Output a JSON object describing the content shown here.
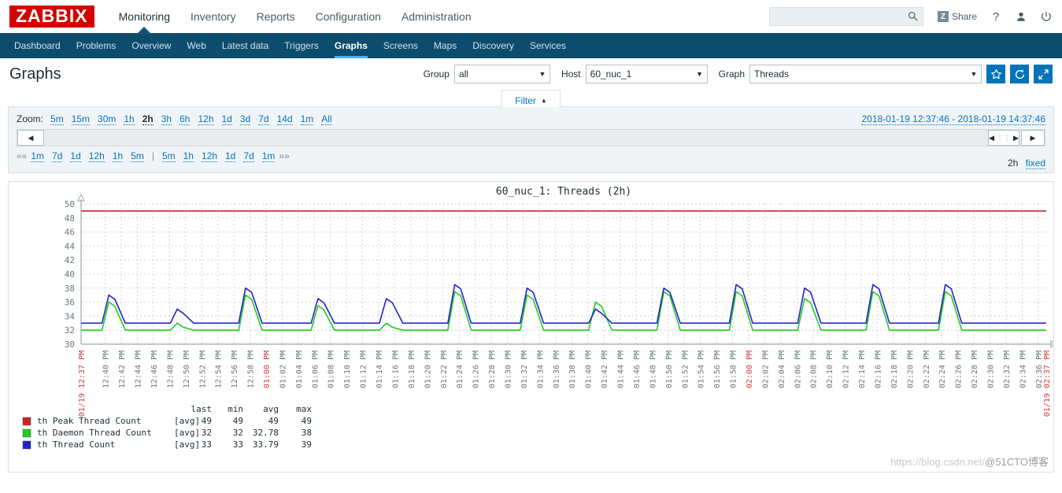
{
  "header": {
    "logo": "ZABBIX",
    "menu": [
      {
        "label": "Monitoring",
        "active": true
      },
      {
        "label": "Inventory",
        "active": false
      },
      {
        "label": "Reports",
        "active": false
      },
      {
        "label": "Configuration",
        "active": false
      },
      {
        "label": "Administration",
        "active": false
      }
    ],
    "search": {
      "value": "",
      "placeholder": ""
    },
    "share_label": "Share",
    "share_badge": "Z",
    "help_icon": "?",
    "user_icon": "user-icon",
    "power_icon": "power-icon"
  },
  "subnav": [
    {
      "label": "Dashboard",
      "active": false
    },
    {
      "label": "Problems",
      "active": false
    },
    {
      "label": "Overview",
      "active": false
    },
    {
      "label": "Web",
      "active": false
    },
    {
      "label": "Latest data",
      "active": false
    },
    {
      "label": "Triggers",
      "active": false
    },
    {
      "label": "Graphs",
      "active": true
    },
    {
      "label": "Screens",
      "active": false
    },
    {
      "label": "Maps",
      "active": false
    },
    {
      "label": "Discovery",
      "active": false
    },
    {
      "label": "Services",
      "active": false
    }
  ],
  "page": {
    "title": "Graphs",
    "group_label": "Group",
    "group_value": "all",
    "host_label": "Host",
    "host_value": "60_nuc_1",
    "graph_label": "Graph",
    "graph_value": "Threads",
    "favorite_icon": "star-icon",
    "refresh_icon": "refresh-icon",
    "fullscreen_icon": "expand-icon"
  },
  "filter": {
    "tab_label": "Filter",
    "tab_arrow": "▲",
    "zoom_label": "Zoom:",
    "zoom_options": [
      {
        "label": "5m",
        "current": false
      },
      {
        "label": "15m",
        "current": false
      },
      {
        "label": "30m",
        "current": false
      },
      {
        "label": "1h",
        "current": false
      },
      {
        "label": "2h",
        "current": true
      },
      {
        "label": "3h",
        "current": false
      },
      {
        "label": "6h",
        "current": false
      },
      {
        "label": "12h",
        "current": false
      },
      {
        "label": "1d",
        "current": false
      },
      {
        "label": "3d",
        "current": false
      },
      {
        "label": "7d",
        "current": false
      },
      {
        "label": "14d",
        "current": false
      },
      {
        "label": "1m",
        "current": false
      },
      {
        "label": "All",
        "current": false
      }
    ],
    "date_range": "2018-01-19 12:37:46 - 2018-01-19 14:37:46",
    "nav_back_icon": "◀",
    "nav_scroll_left_icon": "◀",
    "nav_scroll_dots": "⋮⋮",
    "nav_scroll_right_icon": "▶",
    "nav_forward_icon": "▶",
    "back_links_prefix": "««",
    "back_links": [
      "1m",
      "7d",
      "1d",
      "12h",
      "1h",
      "5m"
    ],
    "link_separator": "|",
    "forward_links": [
      "5m",
      "1h",
      "12h",
      "1d",
      "7d",
      "1m"
    ],
    "forward_links_suffix": "»»",
    "period_value": "2h",
    "period_mode": "fixed"
  },
  "watermark": {
    "url": "https://blog.csdn.net/",
    "cn": "@51CTO博客"
  },
  "chart_data": {
    "type": "line",
    "title": "60_nuc_1:  Threads  (2h)",
    "xlabel": "",
    "ylabel": "",
    "ylim": [
      30,
      50
    ],
    "yticks": [
      30,
      32,
      34,
      36,
      38,
      40,
      42,
      44,
      46,
      48,
      50
    ],
    "grid": true,
    "legend_position": "bottom",
    "x_start": "2018-01-19 12:37:46",
    "x_end": "2018-01-19 14:37:46",
    "x_start_label": "01/19 12:37 PM",
    "x_end_label": "01/19 02:37 PM",
    "xtick_labels": [
      "12:40 PM",
      "12:42 PM",
      "12:44 PM",
      "12:46 PM",
      "12:48 PM",
      "12:50 PM",
      "12:52 PM",
      "12:54 PM",
      "12:56 PM",
      "12:58 PM",
      "01:00 PM",
      "01:02 PM",
      "01:04 PM",
      "01:06 PM",
      "01:08 PM",
      "01:10 PM",
      "01:12 PM",
      "01:14 PM",
      "01:16 PM",
      "01:18 PM",
      "01:20 PM",
      "01:22 PM",
      "01:24 PM",
      "01:26 PM",
      "01:28 PM",
      "01:30 PM",
      "01:32 PM",
      "01:34 PM",
      "01:36 PM",
      "01:38 PM",
      "01:40 PM",
      "01:42 PM",
      "01:44 PM",
      "01:46 PM",
      "01:48 PM",
      "01:50 PM",
      "01:52 PM",
      "01:54 PM",
      "01:56 PM",
      "01:58 PM",
      "02:00 PM",
      "02:02 PM",
      "02:04 PM",
      "02:06 PM",
      "02:08 PM",
      "02:10 PM",
      "02:12 PM",
      "02:14 PM",
      "02:16 PM",
      "02:18 PM",
      "02:20 PM",
      "02:22 PM",
      "02:24 PM",
      "02:26 PM",
      "02:28 PM",
      "02:30 PM",
      "02:32 PM",
      "02:34 PM",
      "02:36 PM"
    ],
    "hour_tick_indices": [
      10,
      40
    ],
    "legend_columns": [
      "last",
      "min",
      "avg",
      "max"
    ],
    "series": [
      {
        "name": "th Peak Thread Count",
        "color": "#CC2222",
        "aggregate": "[avg]",
        "last": "49",
        "min": "49",
        "avg": "49",
        "max": "49",
        "constant": 49,
        "values": []
      },
      {
        "name": "th Daemon Thread Count",
        "color": "#22CC22",
        "aggregate": "[avg]",
        "last": "32",
        "min": "32",
        "avg": "32.78",
        "max": "38",
        "baseline": 32,
        "peaks": [
          {
            "t": 4.0,
            "v": 36
          },
          {
            "t": 12.5,
            "v": 33
          },
          {
            "t": 21.0,
            "v": 37
          },
          {
            "t": 30.0,
            "v": 35.5
          },
          {
            "t": 38.5,
            "v": 33
          },
          {
            "t": 47.0,
            "v": 37.5
          },
          {
            "t": 56.0,
            "v": 37
          },
          {
            "t": 64.5,
            "v": 36
          },
          {
            "t": 73.0,
            "v": 37.5
          },
          {
            "t": 82.0,
            "v": 37.5
          },
          {
            "t": 90.5,
            "v": 36.5
          },
          {
            "t": 99.0,
            "v": 37.5
          },
          {
            "t": 108.0,
            "v": 37.5
          }
        ]
      },
      {
        "name": "th Thread Count",
        "color": "#2222CC",
        "aggregate": "[avg]",
        "last": "33",
        "min": "33",
        "avg": "33.79",
        "max": "39",
        "baseline": 33,
        "peaks": [
          {
            "t": 4.0,
            "v": 37
          },
          {
            "t": 12.5,
            "v": 35
          },
          {
            "t": 21.0,
            "v": 38
          },
          {
            "t": 30.0,
            "v": 36.5
          },
          {
            "t": 38.5,
            "v": 36.5
          },
          {
            "t": 47.0,
            "v": 38.5
          },
          {
            "t": 56.0,
            "v": 38
          },
          {
            "t": 64.5,
            "v": 35
          },
          {
            "t": 73.0,
            "v": 38
          },
          {
            "t": 82.0,
            "v": 38.5
          },
          {
            "t": 90.5,
            "v": 38
          },
          {
            "t": 99.0,
            "v": 38.5
          },
          {
            "t": 108.0,
            "v": 38.5
          }
        ]
      }
    ]
  }
}
